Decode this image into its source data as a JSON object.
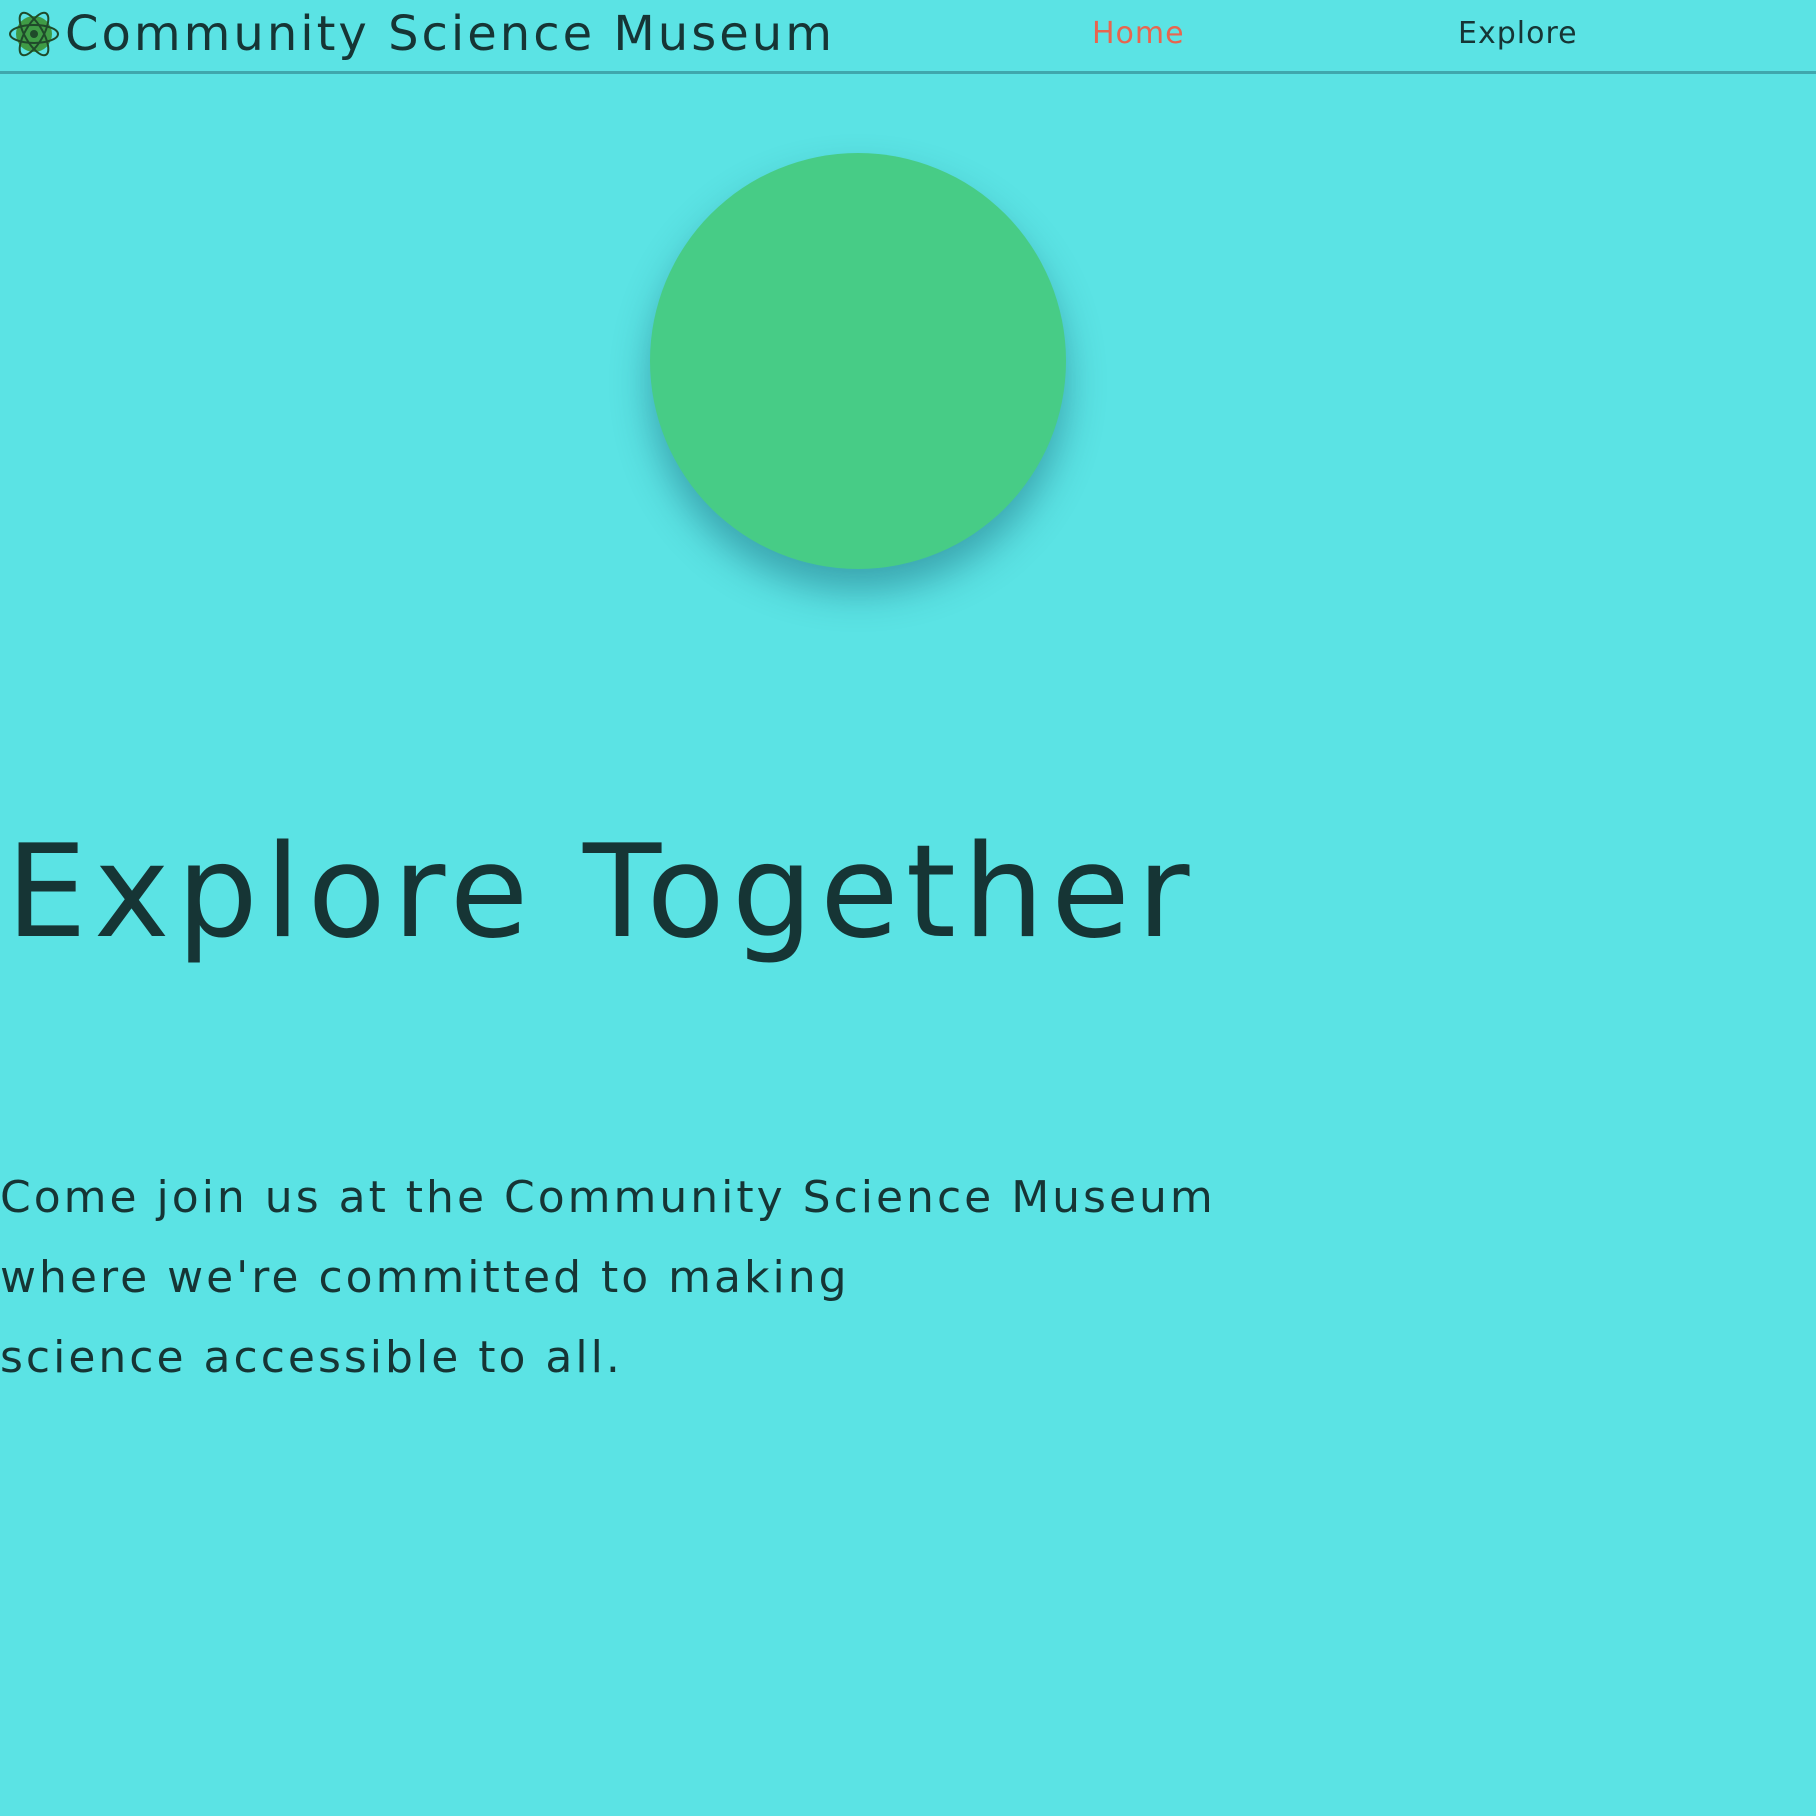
{
  "header": {
    "logo_icon": "atom-logo-icon",
    "title": "Community Science Museum",
    "nav": [
      {
        "label": "Home",
        "active": true,
        "color": "#e8654f"
      },
      {
        "label": "Explore",
        "active": false
      }
    ]
  },
  "hero": {
    "circle_color": "#47cc86",
    "heading": "Explore Together",
    "text_lines": [
      "Come join us at the Community Science Museum",
      "where we're committed to making",
      "science accessible to all."
    ]
  },
  "colors": {
    "background": "#5be3e4",
    "text": "#163535",
    "accent": "#e8654f"
  }
}
